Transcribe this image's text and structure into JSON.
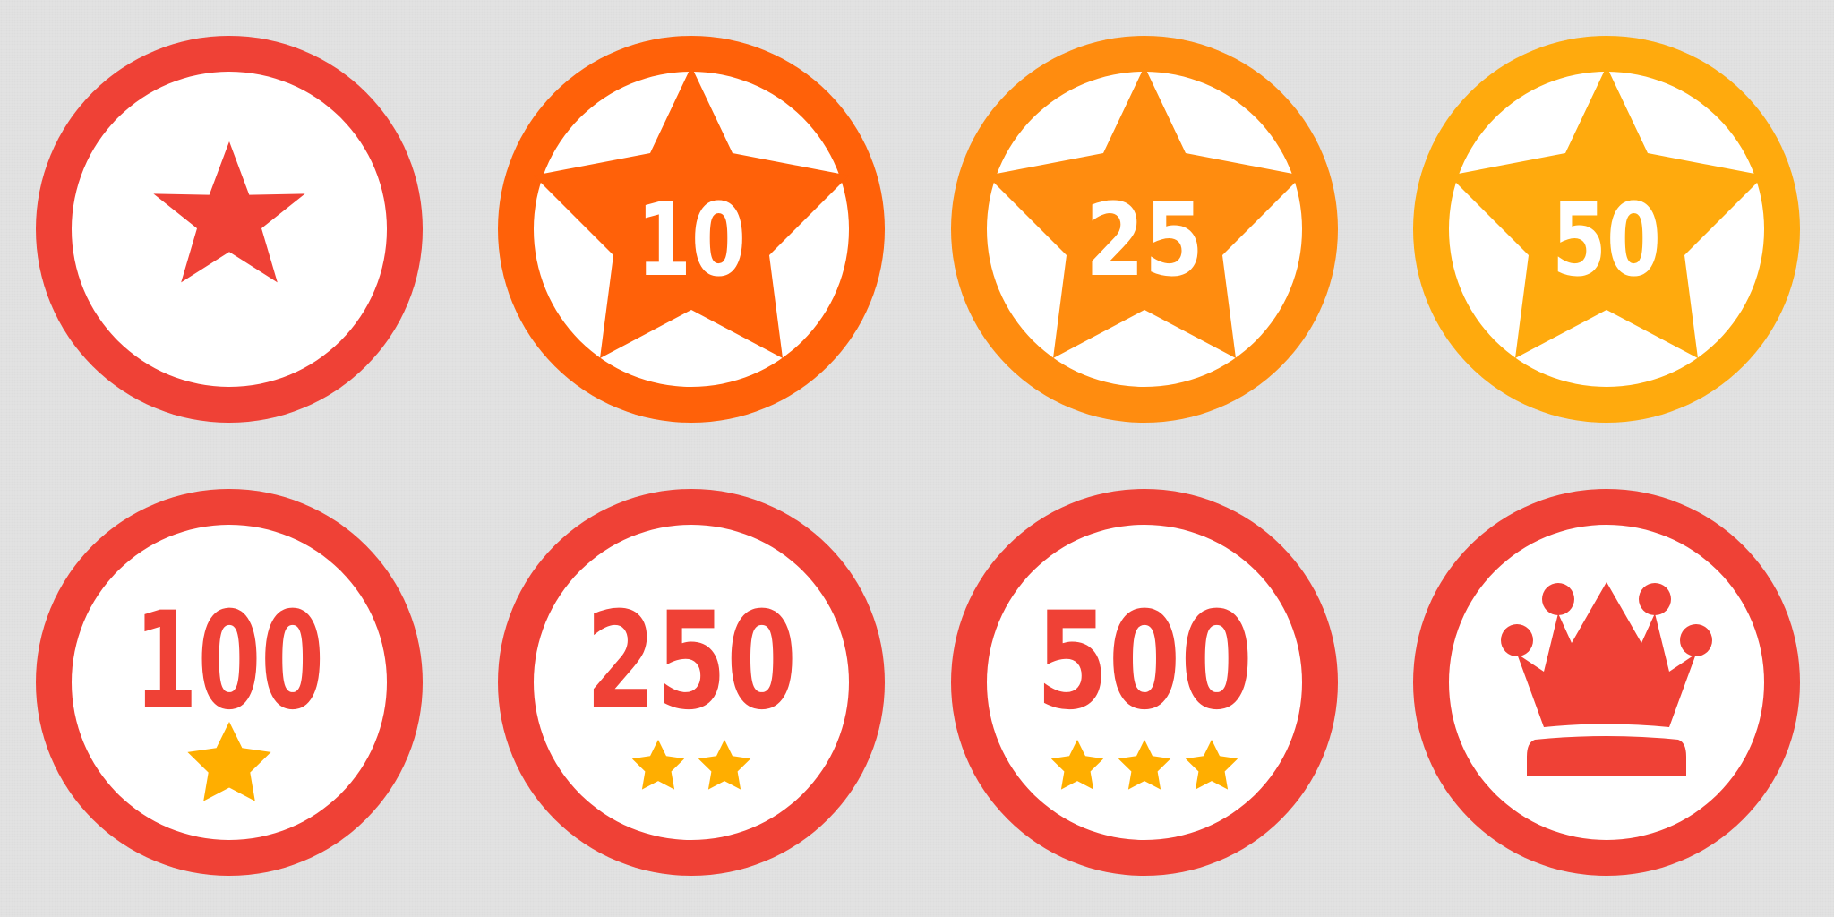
{
  "palette": {
    "background": "#e2e2e2",
    "red": "#ef4136",
    "orange_dark": "#ff6109",
    "orange": "#ff8c0f",
    "amber": "#ffaa0d",
    "gold": "#ffae00",
    "white": "#ffffff"
  },
  "badges": [
    {
      "id": "badge-first-star",
      "label": "",
      "stars": 0,
      "ring": "#ef4136",
      "style": "small-star"
    },
    {
      "id": "badge-10",
      "label": "10",
      "stars": 0,
      "ring": "#ff6109",
      "style": "big-star"
    },
    {
      "id": "badge-25",
      "label": "25",
      "stars": 0,
      "ring": "#ff8c0f",
      "style": "big-star"
    },
    {
      "id": "badge-50",
      "label": "50",
      "stars": 0,
      "ring": "#ffaa0d",
      "style": "big-star"
    },
    {
      "id": "badge-100",
      "label": "100",
      "stars": 1,
      "ring": "#ef4136",
      "style": "number"
    },
    {
      "id": "badge-250",
      "label": "250",
      "stars": 2,
      "ring": "#ef4136",
      "style": "number"
    },
    {
      "id": "badge-500",
      "label": "500",
      "stars": 3,
      "ring": "#ef4136",
      "style": "number"
    },
    {
      "id": "badge-crown",
      "label": "",
      "stars": 0,
      "ring": "#ef4136",
      "style": "crown"
    }
  ]
}
